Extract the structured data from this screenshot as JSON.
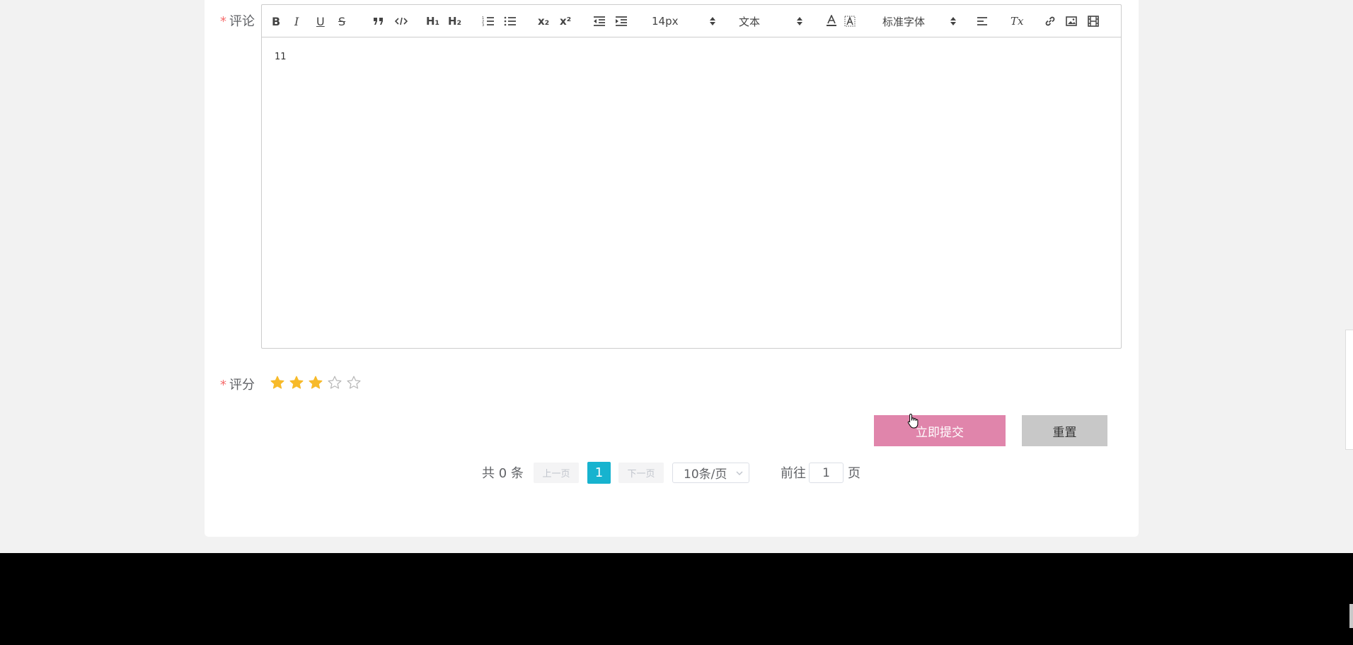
{
  "form": {
    "comment_label": "评论",
    "rating_label": "评分",
    "required_mark": "*",
    "comment_text": "11",
    "rating_value": 3,
    "rating_max": 5,
    "star_color": "#f7ba2a"
  },
  "toolbar": {
    "bold": "B",
    "italic": "I",
    "underline": "U",
    "strike": "S",
    "h1": "H₁",
    "h2": "H₂",
    "sub": "x₂",
    "sup": "x²",
    "font_size": "14px",
    "header": "文本",
    "font_family": "标准字体",
    "clean": "Tx",
    "icons": [
      "bold-icon",
      "italic-icon",
      "underline-icon",
      "strike-icon",
      "blockquote-icon",
      "code-block-icon",
      "header1-icon",
      "header2-icon",
      "ordered-list-icon",
      "bullet-list-icon",
      "subscript-icon",
      "superscript-icon",
      "outdent-icon",
      "indent-icon",
      "text-color-icon",
      "background-color-icon",
      "align-icon",
      "clear-format-icon",
      "link-icon",
      "image-icon",
      "video-icon"
    ]
  },
  "actions": {
    "submit_label": "立即提交",
    "reset_label": "重置",
    "submit_color": "#e085ab",
    "reset_color": "#c8c8c8"
  },
  "pagination": {
    "total": "共 0 条",
    "prev": "上一页",
    "current": "1",
    "next": "下一页",
    "page_size": "10条/页",
    "goto": "前往",
    "goto_value": "1",
    "page_unit": "页",
    "active_color": "#17b3cf"
  }
}
